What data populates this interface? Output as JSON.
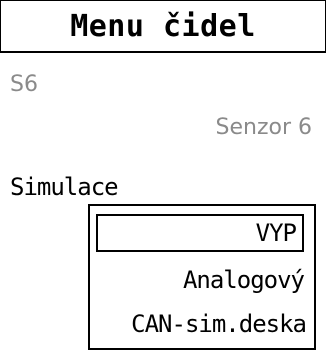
{
  "title": "Menu čidel",
  "sensor": {
    "id": "S6",
    "name": "Senzor 6"
  },
  "simulation": {
    "label": "Simulace",
    "options": [
      "VYP",
      "Analogový",
      "CAN-sim.deska"
    ],
    "selected": "VYP"
  }
}
